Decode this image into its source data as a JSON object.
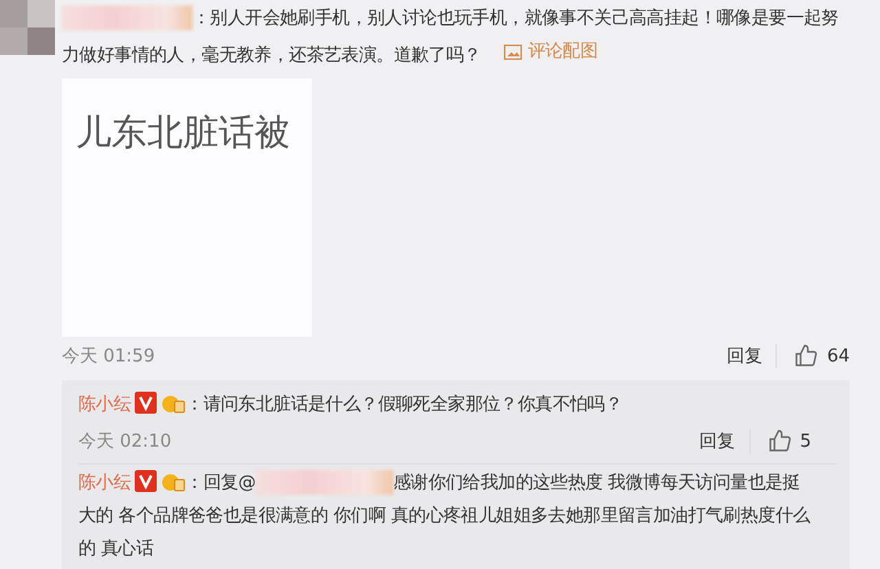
{
  "comment": {
    "text": "：别人开会她刷手机，别人讨论也玩手机，就像事不关己高高挂起！哪像是要一起努力做好事情的人，毫无教养，还茶艺表演。道歉了吗？",
    "attach_link": "评论配图",
    "image_caption": "儿东北脏话被",
    "time": "今天 01:59",
    "reply_label": "回复",
    "likes": "64"
  },
  "replies": [
    {
      "author": "陈小纭",
      "text": "：请问东北脏话是什么？假聊死全家那位？你真不怕吗？",
      "time": "今天 02:10",
      "reply_label": "回复",
      "likes": "5"
    },
    {
      "author": "陈小纭",
      "prefix": "：回复@",
      "text": "感谢你们给我加的这些热度 我微博每天访问量也是挺大的 各个品牌爸爸也是很满意的 你们啊 真的心疼祖儿姐姐多去她那里留言加油打气刷热度什么的 真心话"
    }
  ]
}
